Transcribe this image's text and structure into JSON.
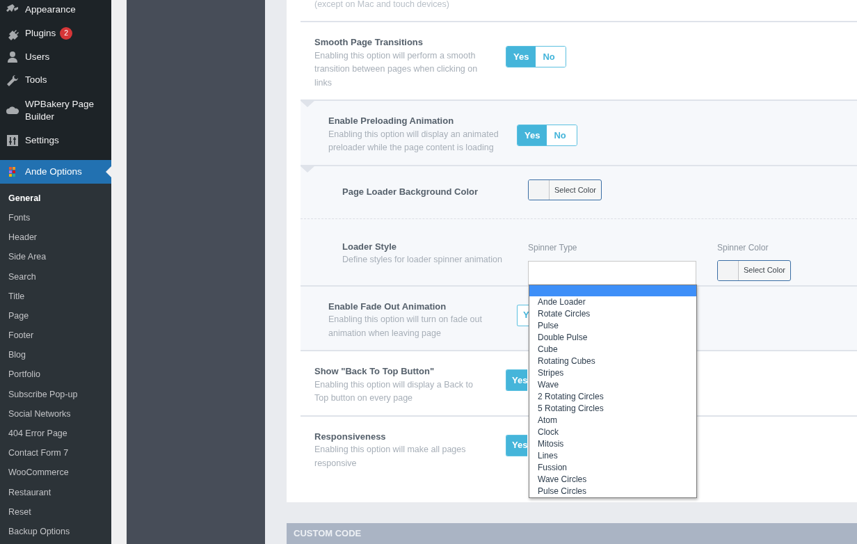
{
  "sidebar": {
    "items": [
      {
        "label": "Appearance",
        "selected": false
      },
      {
        "label": "Plugins",
        "badge": "2",
        "selected": false
      },
      {
        "label": "Users",
        "selected": false
      },
      {
        "label": "Tools",
        "selected": false
      },
      {
        "label": "WPBakery Page Builder",
        "selected": false
      },
      {
        "label": "Settings",
        "selected": false
      },
      {
        "label": "Ande Options",
        "selected": true
      }
    ],
    "submenu": [
      {
        "label": "General",
        "selected": true
      },
      {
        "label": "Fonts",
        "selected": false
      },
      {
        "label": "Header",
        "selected": false
      },
      {
        "label": "Side Area",
        "selected": false
      },
      {
        "label": "Search",
        "selected": false
      },
      {
        "label": "Title",
        "selected": false
      },
      {
        "label": "Page",
        "selected": false
      },
      {
        "label": "Footer",
        "selected": false
      },
      {
        "label": "Blog",
        "selected": false
      },
      {
        "label": "Portfolio",
        "selected": false
      },
      {
        "label": "Subscribe Pop-up",
        "selected": false
      },
      {
        "label": "Social Networks",
        "selected": false
      },
      {
        "label": "404 Error Page",
        "selected": false
      },
      {
        "label": "Contact Form 7",
        "selected": false
      },
      {
        "label": "WooCommerce",
        "selected": false
      },
      {
        "label": "Restaurant",
        "selected": false
      },
      {
        "label": "Reset",
        "selected": false
      },
      {
        "label": "Backup Options",
        "selected": false
      }
    ]
  },
  "options": [
    {
      "kind": "note",
      "description": "(except on Mac and touch devices)"
    },
    {
      "kind": "toggle",
      "title": "Smooth Page Transitions",
      "description": "Enabling this option will perform a smooth transition between pages when clicking on links",
      "toggle": [
        {
          "label": "Yes",
          "selected": true
        },
        {
          "label": "No",
          "selected": false
        }
      ],
      "children": [
        {
          "kind": "toggle",
          "title": "Enable Preloading Animation",
          "description": "Enabling this option will display an animated preloader while the page content is loading",
          "toggle": [
            {
              "label": "Yes",
              "selected": true
            },
            {
              "label": "No",
              "selected": false
            }
          ],
          "children": [
            {
              "kind": "color",
              "title": "Page Loader Background Color",
              "button": "Select Color"
            },
            {
              "kind": "loader",
              "title": "Loader Style",
              "description": "Define styles for loader spinner animation",
              "spinner_type": {
                "label": "Spinner Type",
                "options": [
                  {
                    "selected": true
                  },
                  {
                    "label": "Ande Loader",
                    "selected": false
                  },
                  {
                    "label": "Rotate Circles",
                    "selected": false
                  },
                  {
                    "label": "Pulse",
                    "selected": false
                  },
                  {
                    "label": "Double Pulse",
                    "selected": false
                  },
                  {
                    "label": "Cube",
                    "selected": false
                  },
                  {
                    "label": "Rotating Cubes",
                    "selected": false
                  },
                  {
                    "label": "Stripes",
                    "selected": false
                  },
                  {
                    "label": "Wave",
                    "selected": false
                  },
                  {
                    "label": "2 Rotating Circles",
                    "selected": false
                  },
                  {
                    "label": "5 Rotating Circles",
                    "selected": false
                  },
                  {
                    "label": "Atom",
                    "selected": false
                  },
                  {
                    "label": "Clock",
                    "selected": false
                  },
                  {
                    "label": "Mitosis",
                    "selected": false
                  },
                  {
                    "label": "Lines",
                    "selected": false
                  },
                  {
                    "label": "Fussion",
                    "selected": false
                  },
                  {
                    "label": "Wave Circles",
                    "selected": false
                  },
                  {
                    "label": "Pulse Circles",
                    "selected": false
                  }
                ]
              },
              "spinner_color": {
                "label": "Spinner Color",
                "button": "Select Color"
              }
            }
          ]
        },
        {
          "kind": "toggle",
          "title": "Enable Fade Out Animation",
          "description": "Enabling this option will turn on fade out animation when leaving page",
          "toggle": [
            {
              "label": "Y",
              "selected": false
            }
          ]
        }
      ]
    },
    {
      "kind": "toggle",
      "title": "Show \"Back To Top Button\"",
      "description": "Enabling this option will display a Back to Top button on every page",
      "toggle": [
        {
          "label": "Yes",
          "selected": true
        }
      ]
    },
    {
      "kind": "toggle",
      "title": "Responsiveness",
      "description": "Enabling this option will make all pages responsive",
      "toggle": [
        {
          "label": "Yes",
          "selected": true
        }
      ]
    }
  ],
  "section": {
    "title": "CUSTOM CODE"
  }
}
